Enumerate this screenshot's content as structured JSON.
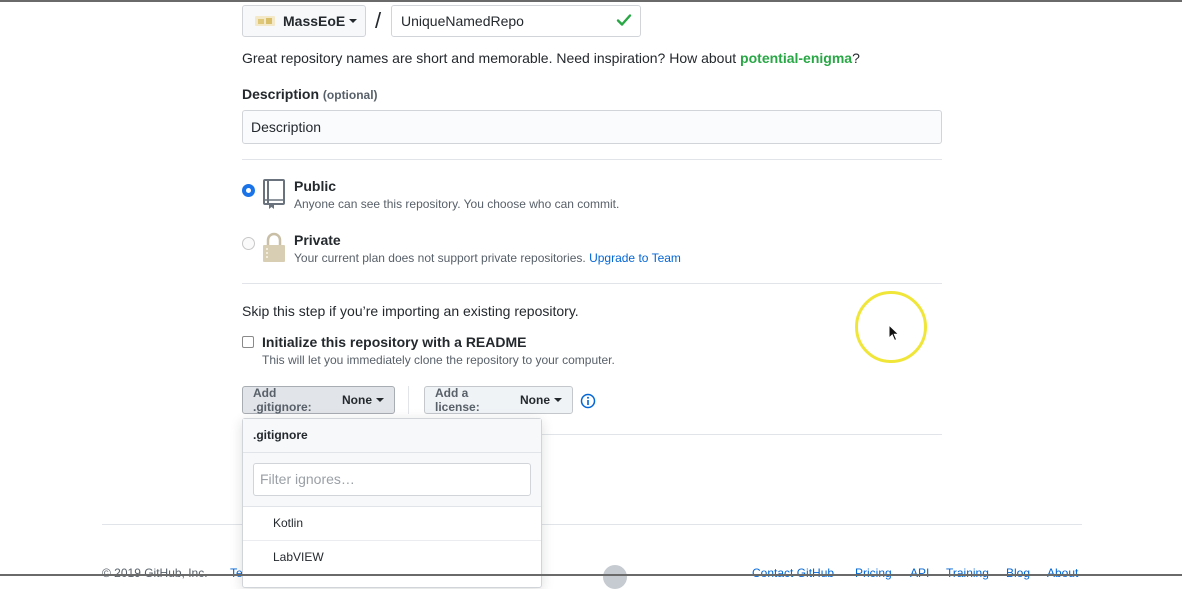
{
  "owner": {
    "name": "MassEoE"
  },
  "repo": {
    "name": "UniqueNamedRepo",
    "valid": true
  },
  "slash": "/",
  "hint": {
    "prefix": "Great repository names are short and memorable. Need inspiration? How about ",
    "suggestion": "potential-enigma",
    "suffix": "?"
  },
  "description": {
    "label": "Description",
    "optional": "(optional)",
    "value": "Description"
  },
  "visibility": {
    "public": {
      "title": "Public",
      "desc": "Anyone can see this repository. You choose who can commit.",
      "selected": true
    },
    "private": {
      "title": "Private",
      "desc": "Your current plan does not support private repositories.",
      "link": "Upgrade to Team",
      "selected": false
    }
  },
  "init": {
    "skip_text": "Skip this step if you’re importing an existing repository.",
    "readme_title": "Initialize this repository with a README",
    "readme_desc": "This will let you immediately clone the repository to your computer.",
    "readme_checked": false
  },
  "gitignore_button": {
    "label": "Add .gitignore:",
    "value": "None"
  },
  "license_button": {
    "label": "Add a license:",
    "value": "None"
  },
  "gitignore_menu": {
    "header": ".gitignore",
    "filter_placeholder": "Filter ignores…",
    "items": [
      "Kotlin",
      "LabVIEW"
    ]
  },
  "footer": {
    "copyright": "© 2019 GitHub, Inc.",
    "left_link": "Te",
    "links": [
      "Contact GitHub",
      "Pricing",
      "API",
      "Training",
      "Blog",
      "About"
    ]
  },
  "colors": {
    "accent_link": "#0366d6",
    "suggestion_green": "#28a745",
    "radio_selected": "#1a73e8",
    "cursor_ring": "#f0e63a"
  }
}
